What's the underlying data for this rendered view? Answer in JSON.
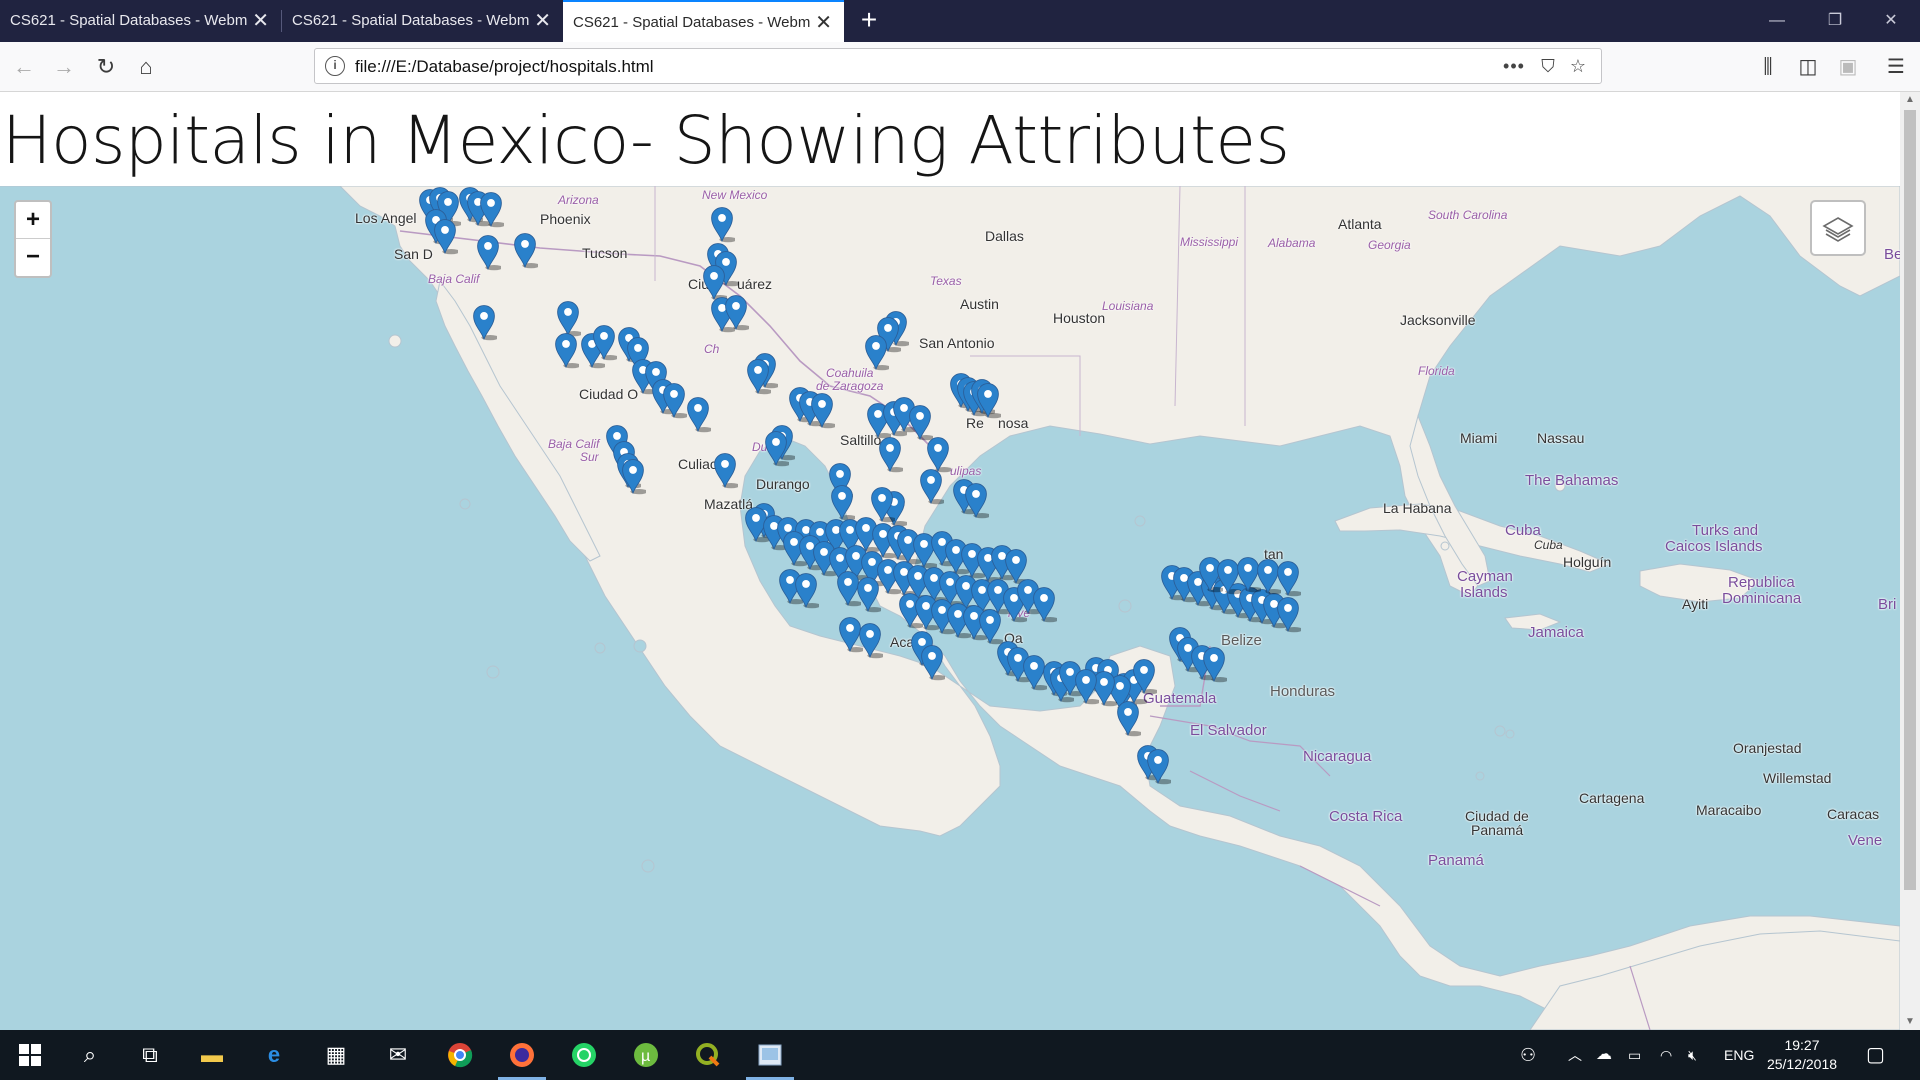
{
  "browser": {
    "tabs": [
      {
        "label": "CS621 - Spatial Databases - Webm",
        "active": false
      },
      {
        "label": "CS621 - Spatial Databases - Webm",
        "active": false
      },
      {
        "label": "CS621 - Spatial Databases - Webm",
        "active": true
      }
    ],
    "new_tab_icon": "plus-icon",
    "url": "file:///E:/Database/project/hospitals.html"
  },
  "page": {
    "title": "Hospitals in Mexico- Showing Attributes"
  },
  "map": {
    "zoom_in_label": "+",
    "zoom_out_label": "−",
    "marker_color": "#2a81cb",
    "labels": {
      "los_angeles": "Los Angel",
      "phoenix": "Phoenix",
      "arizona": "Arizona",
      "new_mexico": "New Mexico",
      "tucson": "Tucson",
      "san_diego": "San D",
      "baja_california": "Baja Calif",
      "dallas": "Dallas",
      "texas": "Texas",
      "austin": "Austin",
      "houston": "Houston",
      "louisiana": "Louisiana",
      "san_antonio": "San Antonio",
      "ciudad_juarez_1": "Ciu",
      "ciudad_juarez_2": "uárez",
      "chihuahua": "Ch",
      "coahuila": "Coahuila",
      "coahuila2": "de Zaragoza",
      "ciudad_obregon": "Ciudad O",
      "reynosa": "Re",
      "reynosa2": "nosa",
      "saltillo": "Saltillo",
      "durango": "Durango",
      "culiacan": "Culiac",
      "mazatlan": "Mazatlá",
      "baja_sur_1": "Baja Calif",
      "baja_sur_2": "Sur",
      "tamaulipas": "ulipas",
      "du": "Du",
      "oaxaca": "Oa",
      "veracruz": "acio",
      "veracruz2": "lave",
      "acapulco": "Aca",
      "atlanta": "Atlanta",
      "south_carolina": "South Carolina",
      "mississippi": "Mississippi",
      "alabama": "Alabama",
      "georgia": "Georgia",
      "jacksonville": "Jacksonville",
      "florida": "Florida",
      "miami": "Miami",
      "nassau": "Nassau",
      "bahamas": "The Bahamas",
      "la_habana": "La Habana",
      "cuba": "Cuba",
      "cuba2": "Cuba",
      "holguin": "Holguín",
      "turks_1": "Turks and",
      "turks_2": "Caicos Islands",
      "cayman_1": "Cayman",
      "cayman_2": "Islands",
      "dominicana_1": "Republica",
      "dominicana_2": "Dominicana",
      "ayiti": "Ayiti",
      "jamaica": "Jamaica",
      "belize": "Belize",
      "honduras": "Honduras",
      "guatemala": "Guatemala",
      "el_salvador": "El Salvador",
      "nicaragua": "Nicaragua",
      "costa_rica": "Costa Rica",
      "ciudad_panama_1": "Ciudad de",
      "ciudad_panama_2": "Panamá",
      "panama": "Panamá",
      "oranjestad": "Oranjestad",
      "willemstad": "Willemstad",
      "cartagena": "Cartagena",
      "maracaibo": "Maracaibo",
      "caracas": "Caracas",
      "vene": "Vene",
      "yucatan": "tan",
      "be": "Be",
      "bri": "Bri"
    }
  },
  "taskbar": {
    "language": "ENG",
    "time": "19:27",
    "date": "25/12/2018"
  }
}
